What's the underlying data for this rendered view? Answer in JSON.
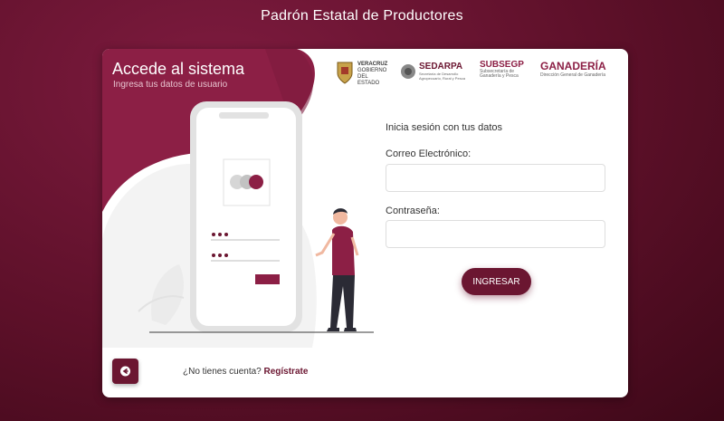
{
  "header": {
    "title": "Padrón Estatal de Productores"
  },
  "card": {
    "title": "Accede al sistema",
    "subtitle": "Ingresa tus datos de usuario"
  },
  "logos": [
    {
      "name": "veracruz-logo",
      "lines": [
        "VERACRUZ",
        "GOBIERNO",
        "DEL ESTADO"
      ]
    },
    {
      "name": "sedarpa-logo",
      "main": "SEDARPA",
      "sub": "Secretaría de Desarrollo Agropecuario, Rural y Pesca"
    },
    {
      "name": "subsegp-logo",
      "main": "SUBSEGP",
      "sub": "Subsecretaría de Ganadería y Pesca"
    },
    {
      "name": "ganaderia-logo",
      "main": "GANADERÍA",
      "sub": "Dirección General de Ganadería"
    }
  ],
  "form": {
    "intro": "Inicia sesión con tus datos",
    "email_label": "Correo Electrónico:",
    "email_value": "",
    "password_label": "Contraseña:",
    "password_value": "",
    "submit_label": "INGRESAR"
  },
  "footer": {
    "register_prompt": "¿No tienes cuenta?",
    "register_link": "Regístrate"
  },
  "colors": {
    "brand": "#6b1631",
    "background": "#5d1029",
    "card": "#ffffff"
  },
  "icons": {
    "back": "arrow-left-circle-icon"
  }
}
